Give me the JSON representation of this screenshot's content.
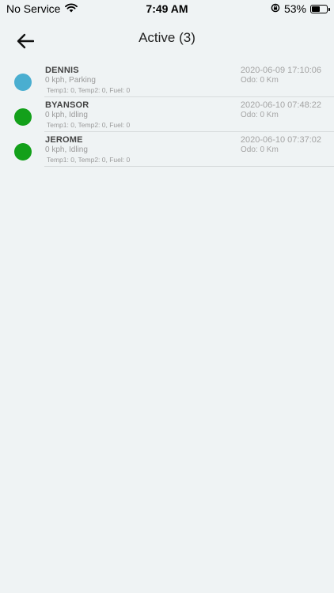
{
  "status_bar": {
    "carrier": "No Service",
    "time": "7:49 AM",
    "battery": "53%",
    "battery_level": 0.53
  },
  "header": {
    "title": "Active (3)"
  },
  "vehicles": [
    {
      "name": "DENNIS",
      "speed_status": "0 kph, Parking",
      "sensors": "Temp1: 0, Temp2: 0, Fuel: 0",
      "timestamp": "2020-06-09 17:10:06",
      "odo": "Odo: 0 Km",
      "status_color": "#4aaed0"
    },
    {
      "name": "BYANSOR",
      "speed_status": "0 kph, Idling",
      "sensors": "Temp1: 0, Temp2: 0, Fuel: 0",
      "timestamp": "2020-06-10 07:48:22",
      "odo": "Odo: 0 Km",
      "status_color": "#13a01a"
    },
    {
      "name": "JEROME",
      "speed_status": "0 kph, Idling",
      "sensors": "Temp1: 0, Temp2: 0, Fuel: 0",
      "timestamp": "2020-06-10 07:37:02",
      "odo": "Odo: 0 Km",
      "status_color": "#13a01a"
    }
  ]
}
